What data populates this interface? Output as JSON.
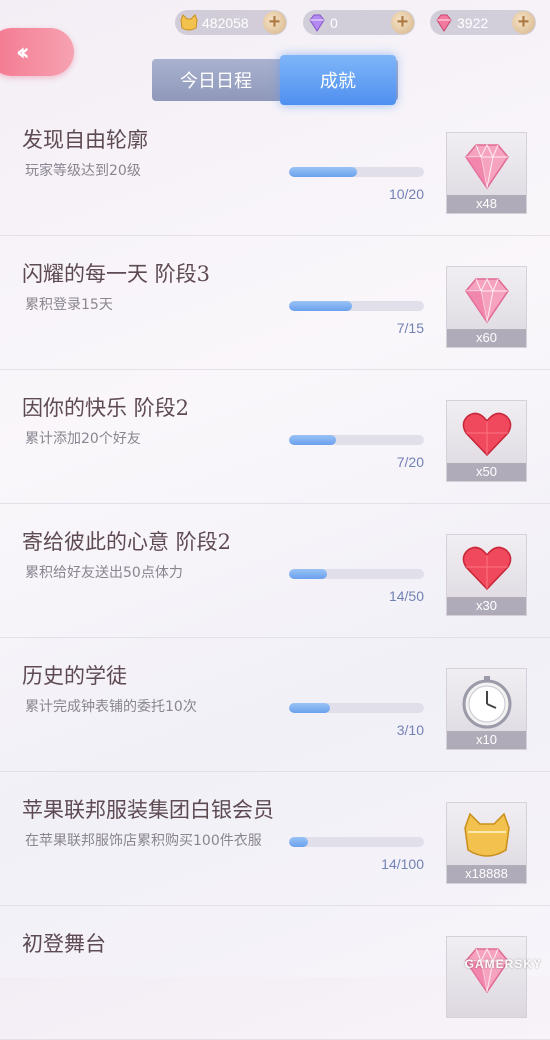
{
  "currencies": [
    {
      "icon": "gold-cat-coin-icon",
      "value": "482058"
    },
    {
      "icon": "purple-diamond-icon",
      "value": "0"
    },
    {
      "icon": "pink-diamond-icon",
      "value": "3922"
    }
  ],
  "tabs": {
    "daily": "今日日程",
    "achievements": "成就"
  },
  "achievements": [
    {
      "title": "发现自由轮廓",
      "desc": "玩家等级达到20级",
      "progress": 0.5,
      "count": "10/20",
      "reward_icon": "pink-diamond-icon",
      "qty": "x48"
    },
    {
      "title": "闪耀的每一天 阶段3",
      "desc": "累积登录15天",
      "progress": 0.47,
      "count": "7/15",
      "reward_icon": "pink-diamond-icon",
      "qty": "x60"
    },
    {
      "title": "因你的快乐 阶段2",
      "desc": "累计添加20个好友",
      "progress": 0.35,
      "count": "7/20",
      "reward_icon": "red-heart-icon",
      "qty": "x50"
    },
    {
      "title": "寄给彼此的心意 阶段2",
      "desc": "累积给好友送出50点体力",
      "progress": 0.28,
      "count": "14/50",
      "reward_icon": "red-heart-icon",
      "qty": "x30"
    },
    {
      "title": "历史的学徒",
      "desc": "累计完成钟表铺的委托10次",
      "progress": 0.3,
      "count": "3/10",
      "reward_icon": "pocket-watch-icon",
      "qty": "x10"
    },
    {
      "title": "苹果联邦服装集团白银会员",
      "desc": "在苹果联邦服饰店累积购买100件衣服",
      "progress": 0.14,
      "count": "14/100",
      "reward_icon": "gold-cat-coin-icon",
      "qty": "x18888"
    },
    {
      "title": "初登舞台",
      "desc": "",
      "progress": 0,
      "count": "",
      "reward_icon": "pink-diamond-icon",
      "qty": ""
    }
  ],
  "watermark": "GAMERSKY",
  "colors": {
    "accent_pink": "#f4778f",
    "tab_active": "#4f8fef",
    "progress_fill": "#6aa0ee"
  }
}
